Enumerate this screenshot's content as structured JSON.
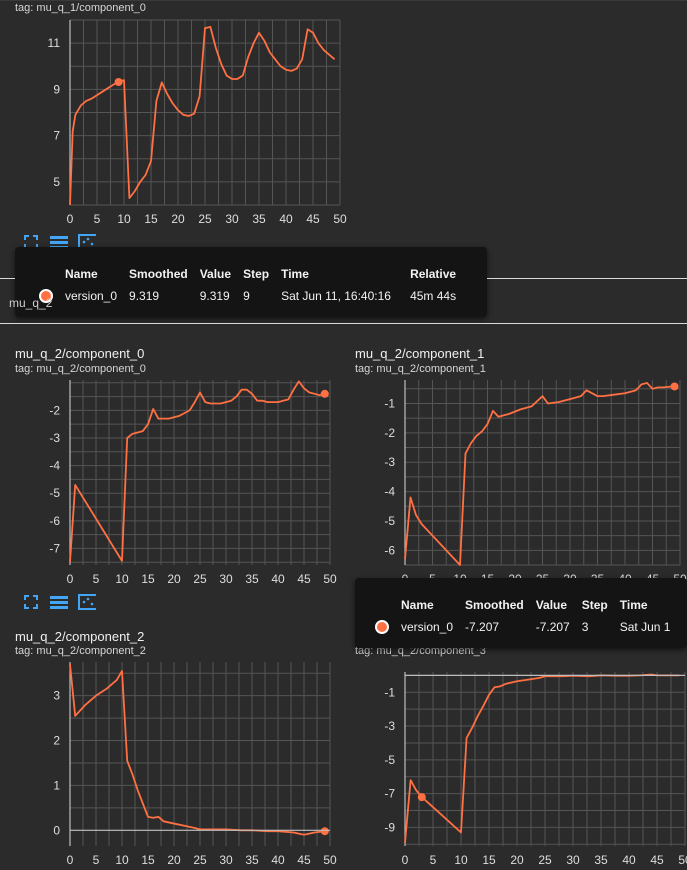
{
  "accent": "#ff7043",
  "top_card": {
    "tag": "tag: mu_q_1/component_0",
    "chart_data": {
      "type": "line",
      "xlim": [
        0,
        50
      ],
      "ylim": [
        4,
        12
      ],
      "x_ticks": [
        "0",
        "5",
        "10",
        "15",
        "20",
        "25",
        "30",
        "35",
        "40",
        "45",
        "50"
      ],
      "y_ticks": [
        "5",
        "7",
        "9",
        "11"
      ],
      "y_tick_values": [
        5,
        7,
        9,
        11
      ],
      "series": [
        {
          "color": "#ff7043",
          "x": [
            0,
            0.5,
            1,
            2,
            3,
            4,
            6,
            8,
            9,
            10,
            11,
            12,
            13,
            14,
            15,
            16,
            17,
            18,
            19,
            20,
            21,
            22,
            23,
            24,
            25,
            26,
            27,
            28,
            29,
            30,
            31,
            32,
            33,
            34,
            35,
            36,
            37,
            38,
            39,
            40,
            41,
            42,
            43,
            44,
            45,
            46,
            47,
            48,
            49
          ],
          "y": [
            4.0,
            7.2,
            7.9,
            8.3,
            8.5,
            8.6,
            8.9,
            9.2,
            9.32,
            9.4,
            4.3,
            4.6,
            5.0,
            5.3,
            5.9,
            8.5,
            9.3,
            8.8,
            8.4,
            8.1,
            7.9,
            7.85,
            7.95,
            8.7,
            11.65,
            11.7,
            10.8,
            10.1,
            9.6,
            9.45,
            9.45,
            9.6,
            10.4,
            11.0,
            11.45,
            11.1,
            10.6,
            10.3,
            10.0,
            9.85,
            9.8,
            9.9,
            10.3,
            11.6,
            11.45,
            11.0,
            10.7,
            10.5,
            10.3
          ]
        }
      ],
      "highlight": {
        "x": 9,
        "y": 9.319
      }
    },
    "tooltip": {
      "headers": [
        "Name",
        "Smoothed",
        "Value",
        "Step",
        "Time",
        "Relative"
      ],
      "row": [
        "version_0",
        "9.319",
        "9.319",
        "9",
        "Sat Jun 11, 16:40:16",
        "45m 44s"
      ]
    }
  },
  "section_label": "mu_q_2",
  "cards": [
    {
      "title": "mu_q_2/component_0",
      "tag": "tag: mu_q_2/component_0",
      "chart_data": {
        "type": "line",
        "xlim": [
          0,
          50
        ],
        "ylim": [
          -7.6,
          -0.9
        ],
        "x_ticks": [
          "0",
          "5",
          "10",
          "15",
          "20",
          "25",
          "30",
          "35",
          "40",
          "45",
          "50"
        ],
        "y_ticks": [
          "-2",
          "-3",
          "-4",
          "-5",
          "-6",
          "-7"
        ],
        "y_tick_values": [
          -2,
          -3,
          -4,
          -5,
          -6,
          -7
        ],
        "series": [
          {
            "color": "#ff7043",
            "x": [
              0,
              1,
              10,
              11,
              12,
              13,
              14,
              15,
              16,
              17,
              18,
              19,
              20,
              21,
              22,
              23,
              24,
              25,
              26,
              27,
              28,
              29,
              30,
              31,
              32,
              33,
              34,
              35,
              36,
              37,
              38,
              39,
              40,
              41,
              42,
              43,
              44,
              45,
              46,
              47,
              48,
              49
            ],
            "y": [
              -7.5,
              -4.7,
              -7.45,
              -3.0,
              -2.85,
              -2.8,
              -2.75,
              -2.5,
              -1.95,
              -2.3,
              -2.3,
              -2.3,
              -2.25,
              -2.2,
              -2.1,
              -2.0,
              -1.7,
              -1.35,
              -1.7,
              -1.75,
              -1.75,
              -1.75,
              -1.7,
              -1.65,
              -1.5,
              -1.25,
              -1.25,
              -1.4,
              -1.65,
              -1.65,
              -1.7,
              -1.7,
              -1.7,
              -1.65,
              -1.6,
              -1.25,
              -0.95,
              -1.2,
              -1.35,
              -1.4,
              -1.45,
              -1.4
            ]
          }
        ],
        "highlight": {
          "x": 49,
          "y": -1.4
        }
      }
    },
    {
      "title": "mu_q_2/component_1",
      "tag": "tag: mu_q_2/component_1",
      "chart_data": {
        "type": "line",
        "xlim": [
          0,
          50
        ],
        "ylim": [
          -6.5,
          -0.2
        ],
        "x_ticks": [
          "0",
          "5",
          "10",
          "15",
          "20",
          "25",
          "30",
          "35",
          "40",
          "45",
          "50"
        ],
        "y_ticks": [
          "-1",
          "-2",
          "-3",
          "-4",
          "-5",
          "-6"
        ],
        "y_tick_values": [
          -1,
          -2,
          -3,
          -4,
          -5,
          -6
        ],
        "series": [
          {
            "color": "#ff7043",
            "x": [
              0,
              1,
              2,
              3,
              5,
              7,
              9,
              10,
              11,
              12,
              13,
              14,
              15,
              16,
              17,
              19,
              21,
              23,
              25,
              26,
              28,
              30,
              32,
              33,
              34,
              35,
              36,
              38,
              40,
              42,
              43,
              44,
              45,
              46,
              47,
              48,
              49
            ],
            "y": [
              -6.3,
              -4.2,
              -4.8,
              -5.1,
              -5.5,
              -5.9,
              -6.3,
              -6.5,
              -2.7,
              -2.35,
              -2.1,
              -1.95,
              -1.7,
              -1.25,
              -1.45,
              -1.35,
              -1.2,
              -1.1,
              -0.75,
              -1.0,
              -0.95,
              -0.85,
              -0.75,
              -0.55,
              -0.65,
              -0.75,
              -0.75,
              -0.7,
              -0.65,
              -0.55,
              -0.35,
              -0.3,
              -0.5,
              -0.45,
              -0.45,
              -0.43,
              -0.42
            ]
          }
        ],
        "highlight": {
          "x": 49,
          "y": -0.42
        }
      },
      "tooltip": {
        "headers": [
          "Name",
          "Smoothed",
          "Value",
          "Step",
          "Time"
        ],
        "row": [
          "version_0",
          "-7.207",
          "-7.207",
          "3",
          "Sat Jun 1"
        ]
      }
    },
    {
      "title": "mu_q_2/component_2",
      "tag": "tag: mu_q_2/component_2",
      "chart_data": {
        "type": "line",
        "xlim": [
          0,
          50
        ],
        "ylim": [
          -0.35,
          3.75
        ],
        "x_ticks": [
          "0",
          "5",
          "10",
          "15",
          "20",
          "25",
          "30",
          "35",
          "40",
          "45",
          "50"
        ],
        "y_ticks": [
          "3",
          "2",
          "1",
          "0"
        ],
        "y_tick_values": [
          3,
          2,
          1,
          0
        ],
        "series": [
          {
            "color": "#ff7043",
            "x": [
              0,
              1,
              3,
              5,
              7,
              9,
              10,
              11,
              12,
              13,
              14,
              15,
              16,
              17,
              18,
              20,
              22,
              24,
              25,
              27,
              30,
              33,
              35,
              38,
              40,
              43,
              45,
              47,
              49
            ],
            "y": [
              3.7,
              2.55,
              2.8,
              3.0,
              3.15,
              3.35,
              3.55,
              1.55,
              1.25,
              0.9,
              0.6,
              0.3,
              0.28,
              0.3,
              0.2,
              0.15,
              0.1,
              0.05,
              0.02,
              0.02,
              0.02,
              0.0,
              0.0,
              -0.02,
              -0.02,
              -0.05,
              -0.1,
              -0.05,
              -0.02
            ]
          }
        ],
        "highlight": {
          "x": 49,
          "y": -0.02
        }
      }
    },
    {
      "title": "",
      "tag": "tag: mu_q_2/component_3",
      "chart_data": {
        "type": "line",
        "xlim": [
          0,
          50
        ],
        "ylim": [
          -10.1,
          0.2
        ],
        "x_ticks": [
          "0",
          "5",
          "10",
          "15",
          "20",
          "25",
          "30",
          "35",
          "40",
          "45",
          "50"
        ],
        "y_ticks": [
          "-1",
          "-3",
          "-5",
          "-7",
          "-9"
        ],
        "y_tick_values": [
          -1,
          -3,
          -5,
          -7,
          -9
        ],
        "series": [
          {
            "color": "#ff7043",
            "x": [
              0,
              1,
              2,
              3,
              4,
              6,
              8,
              10,
              11,
              12,
              13,
              14,
              15,
              16,
              17,
              18,
              20,
              22,
              24,
              25,
              28,
              30,
              33,
              35,
              38,
              40,
              42,
              44,
              45,
              47,
              49
            ],
            "y": [
              -9.9,
              -6.2,
              -6.8,
              -7.2,
              -7.5,
              -8.1,
              -8.7,
              -9.3,
              -3.7,
              -3.1,
              -2.4,
              -1.8,
              -1.15,
              -0.7,
              -0.65,
              -0.5,
              -0.35,
              -0.25,
              -0.15,
              -0.05,
              -0.05,
              -0.02,
              -0.05,
              0.0,
              -0.02,
              -0.02,
              0.0,
              0.05,
              0.0,
              0.0,
              0.0
            ]
          }
        ],
        "highlight": {
          "x": 3,
          "y": -7.207
        }
      }
    }
  ]
}
